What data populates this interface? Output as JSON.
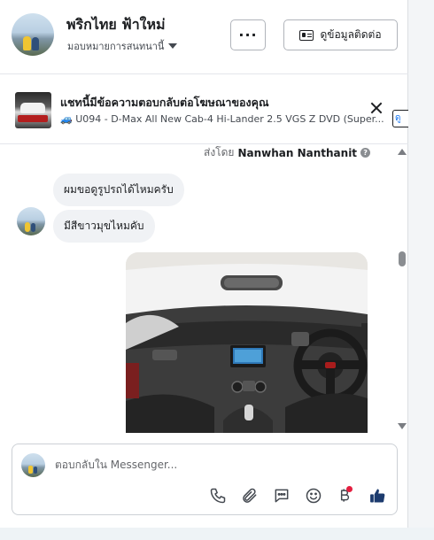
{
  "header": {
    "name": "พริกไทย ฟ้าใหม่",
    "assign_label": "มอบหมายการสนทนานี้",
    "more_label": "···",
    "contact_label": "ดูข้อมูลติดต่อ"
  },
  "ad": {
    "title": "แชทนี้มีข้อความตอบกลับต่อโฆษณาของคุณ",
    "description": "🚙 U094 - D-Max All New Cab-4 Hi-Lander 2.5 VGS Z DVD (Super...",
    "view_label": "ดู"
  },
  "conversation": {
    "sent_by_prefix": "ส่งโดย",
    "sent_by_name": "Nanwhan Nanthanit",
    "messages": [
      {
        "text": "ผมขอดูรูปรถได้ไหมครับ"
      },
      {
        "text": "มีสีขาวมุขไหมคับ"
      }
    ]
  },
  "composer": {
    "placeholder": "ตอบกลับใน Messenger..."
  },
  "icons": {
    "more": "more-horizontal-icon",
    "contact": "contact-card-icon",
    "close": "close-icon",
    "help": "help-icon",
    "phone": "phone-icon",
    "attach": "paperclip-icon",
    "saved_replies": "chat-bubble-icon",
    "emoji": "emoji-icon",
    "payment": "baht-icon",
    "like": "thumbs-up-icon"
  },
  "colors": {
    "accent": "#1877f2",
    "bubble": "#f0f2f5",
    "notification": "#e41e3f"
  }
}
